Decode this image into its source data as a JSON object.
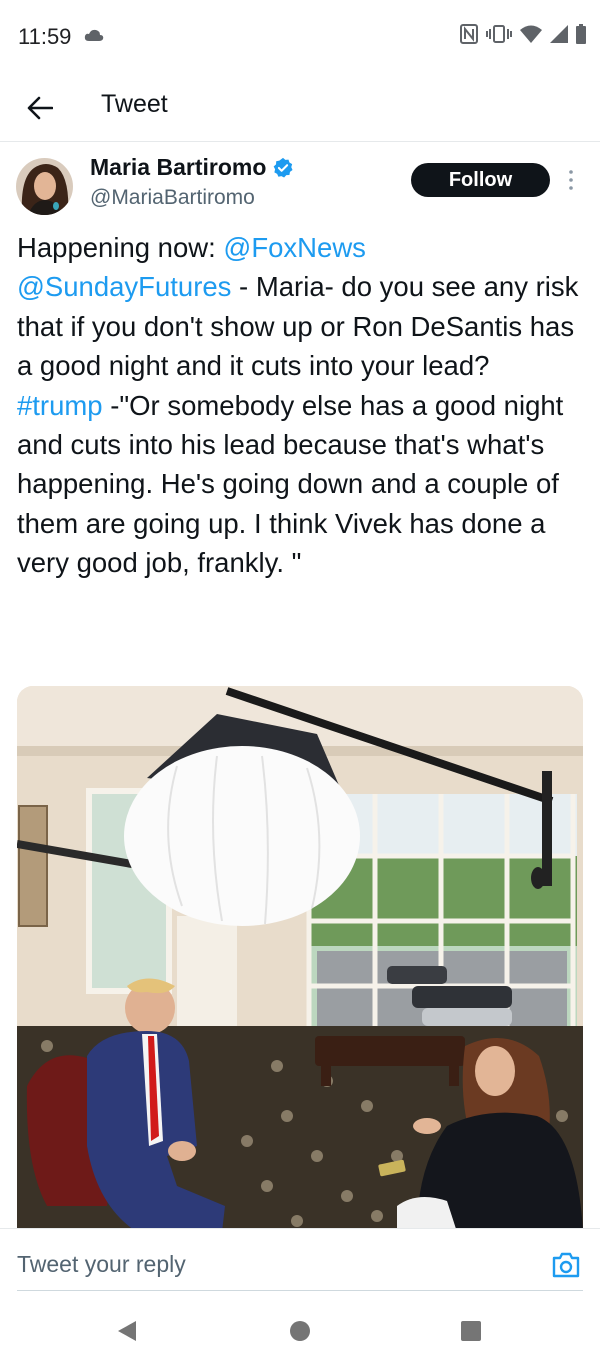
{
  "status_bar": {
    "time": "11:59",
    "icons": [
      "cloud-icon",
      "nfc-icon",
      "vibrate-icon",
      "wifi-icon",
      "signal-icon",
      "battery-icon"
    ]
  },
  "app_bar": {
    "back_icon": "arrow-left-icon",
    "title": "Tweet"
  },
  "author": {
    "name": "Maria Bartiromo",
    "handle": "@MariaBartiromo",
    "verified": true,
    "follow_label": "Follow"
  },
  "tweet": {
    "segments": [
      {
        "text": "Happening now: ",
        "type": "text"
      },
      {
        "text": "@FoxNews",
        "type": "link"
      },
      {
        "text": "\n",
        "type": "text"
      },
      {
        "text": "@SundayFutures",
        "type": "link"
      },
      {
        "text": " - Maria- do you see any risk that if you don't show up or Ron DeSantis has a good night and it cuts into your lead?\n",
        "type": "text"
      },
      {
        "text": "#trump",
        "type": "link"
      },
      {
        "text": " -\"Or somebody else has a good night and cuts into his lead because that's what's happening. He's going down and a couple of them are going up. I think Vivek has done a very good job, frankly. \"",
        "type": "text"
      }
    ]
  },
  "reply": {
    "placeholder": "Tweet your reply",
    "camera_icon": "camera-icon"
  },
  "nav": {
    "back": "nav-back-icon",
    "home": "nav-home-icon",
    "recent": "nav-recent-icon"
  },
  "colors": {
    "link": "#1d9bf0",
    "text": "#0f1419",
    "secondary": "#536471",
    "verified": "#1d9bf0"
  }
}
